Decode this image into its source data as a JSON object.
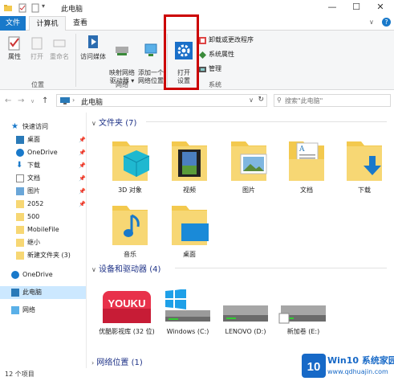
{
  "window": {
    "title": "此电脑",
    "minimize": "—",
    "maximize": "☐",
    "close": "✕",
    "help": "?"
  },
  "tabs": [
    "文件",
    "计算机",
    "查看"
  ],
  "ribbon": {
    "location_group": {
      "label": "位置",
      "buttons": [
        "属性",
        "打开",
        "重命名"
      ]
    },
    "network_group": {
      "label": "网络",
      "buttons": [
        "访问媒体",
        "映射网络\n驱动器 ▾",
        "添加一个\n网络位置"
      ]
    },
    "system_group": {
      "label": "系统",
      "open_settings": "打开\n设置",
      "small_items": [
        "卸载或更改程序",
        "系统属性",
        "管理"
      ]
    }
  },
  "addressbar": {
    "path": "此电脑",
    "search_placeholder": "搜索\"此电脑\""
  },
  "navpane": {
    "items": [
      {
        "label": "快速访问",
        "pinned": false
      },
      {
        "label": "桌面",
        "pinned": true
      },
      {
        "label": "OneDrive",
        "pinned": true
      },
      {
        "label": "下载",
        "pinned": true
      },
      {
        "label": "文档",
        "pinned": true
      },
      {
        "label": "图片",
        "pinned": true
      },
      {
        "label": "2052",
        "pinned": true
      },
      {
        "label": "500",
        "pinned": false
      },
      {
        "label": "MobileFile",
        "pinned": false
      },
      {
        "label": "继小",
        "pinned": false
      },
      {
        "label": "新建文件夹 (3)",
        "pinned": false
      },
      {
        "label": "OneDrive",
        "pinned": false
      },
      {
        "label": "此电脑",
        "pinned": false
      },
      {
        "label": "网络",
        "pinned": false
      }
    ],
    "pin_glyph": "📌"
  },
  "content": {
    "folders_header": "文件夹 (7)",
    "folders": [
      "3D 对象",
      "视频",
      "图片",
      "文档",
      "下载",
      "音乐",
      "桌面"
    ],
    "devices_header": "设备和驱动器 (4)",
    "devices": [
      "优酷影视库 (32 位)",
      "Windows (C:)",
      "LENOVO (D:)",
      "新加卷 (E:)"
    ],
    "youku_brand": "YOUKU",
    "network_header": "网络位置 (1)"
  },
  "statusbar": {
    "text": "12 个项目"
  },
  "watermark": {
    "title": "Win10 系统家园",
    "url": "www.qdhuajin.com",
    "logo_text": "10"
  },
  "colors": {
    "accent": "#1979ca",
    "highlight": "#cc0000",
    "folder": "#f7d774",
    "header": "#1e3287"
  }
}
